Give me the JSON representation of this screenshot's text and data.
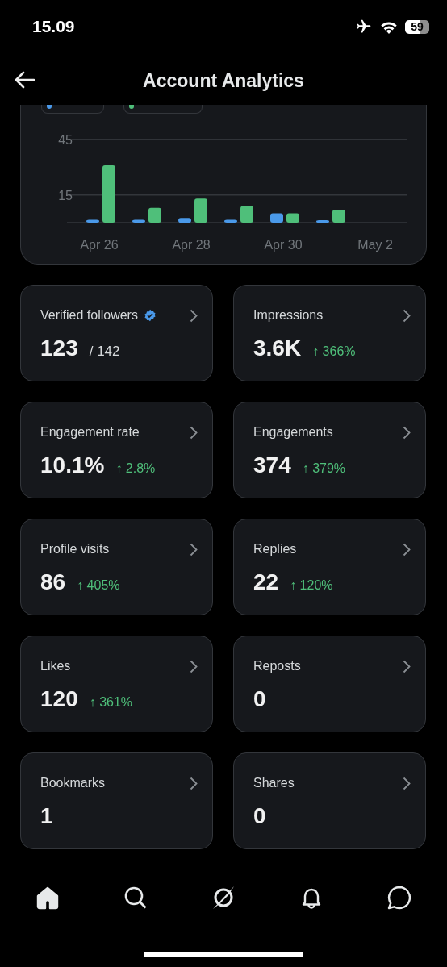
{
  "status_bar": {
    "time": "15.09",
    "battery": "59"
  },
  "header": {
    "title": "Account Analytics"
  },
  "chart": {
    "legend": [
      {
        "color": "#4a99e9"
      },
      {
        "color": "#4fbf7a"
      }
    ],
    "chart_data": {
      "type": "bar",
      "categories": [
        "Apr 26",
        null,
        "Apr 28",
        null,
        "Apr 30",
        null,
        "May 2"
      ],
      "series": [
        {
          "color": "#4a99e9",
          "values": [
            1.5,
            1.5,
            2.5,
            1.5,
            5,
            0.7,
            null
          ]
        },
        {
          "color": "#4fbf7a",
          "values": [
            31,
            8,
            13,
            9,
            5,
            7,
            null
          ]
        }
      ],
      "ylim": [
        0,
        45
      ],
      "yticks": [
        15,
        45
      ]
    }
  },
  "cards": [
    {
      "label": "Verified followers",
      "verified": true,
      "value": "123",
      "kind": "total",
      "extra": "/ 142"
    },
    {
      "label": "Impressions",
      "verified": false,
      "value": "3.6K",
      "kind": "change",
      "extra": "↑ 366%"
    },
    {
      "label": "Engagement rate",
      "verified": false,
      "value": "10.1%",
      "kind": "change",
      "extra": "↑ 2.8%"
    },
    {
      "label": "Engagements",
      "verified": false,
      "value": "374",
      "kind": "change",
      "extra": "↑ 379%"
    },
    {
      "label": "Profile visits",
      "verified": false,
      "value": "86",
      "kind": "change",
      "extra": "↑ 405%"
    },
    {
      "label": "Replies",
      "verified": false,
      "value": "22",
      "kind": "change",
      "extra": "↑ 120%"
    },
    {
      "label": "Likes",
      "verified": false,
      "value": "120",
      "kind": "change",
      "extra": "↑ 361%"
    },
    {
      "label": "Reposts",
      "verified": false,
      "value": "0",
      "kind": "plain"
    },
    {
      "label": "Bookmarks",
      "verified": false,
      "value": "1",
      "kind": "plain"
    },
    {
      "label": "Shares",
      "verified": false,
      "value": "0",
      "kind": "plain"
    }
  ],
  "bottom_nav": [
    {
      "kind": "home",
      "selected": true
    },
    {
      "kind": "search",
      "selected": false
    },
    {
      "kind": "explore",
      "selected": false
    },
    {
      "kind": "notifications",
      "selected": false
    },
    {
      "kind": "messages",
      "selected": false
    }
  ]
}
